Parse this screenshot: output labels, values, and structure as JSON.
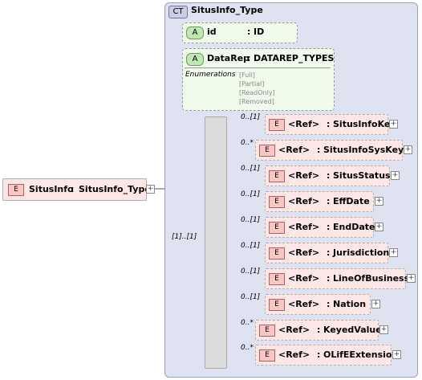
{
  "root": {
    "tag": "E",
    "name": "SitusInfo",
    "type": "SitusInfo_Type",
    "sep": ":"
  },
  "complex_type": {
    "tag": "CT",
    "name": "SitusInfo_Type"
  },
  "attributes": [
    {
      "tag": "A",
      "name": "id",
      "type": "ID"
    },
    {
      "tag": "A",
      "name": "DataRep",
      "type": "DATAREP_TYPES",
      "enum_label": "Enumerations",
      "enums": [
        "[Full]",
        "[Partial]",
        "[ReadOnly]",
        "[Removed]"
      ]
    }
  ],
  "sequence": {
    "cardinality": "[1]..[1]"
  },
  "elements": [
    {
      "card": "0..[1]",
      "tag": "E",
      "ref": "<Ref>",
      "name": "SitusInfoKey"
    },
    {
      "card": "0..*",
      "tag": "E",
      "ref": "<Ref>",
      "name": "SitusInfoSysKey"
    },
    {
      "card": "0..[1]",
      "tag": "E",
      "ref": "<Ref>",
      "name": "SitusStatus"
    },
    {
      "card": "0..[1]",
      "tag": "E",
      "ref": "<Ref>",
      "name": "EffDate"
    },
    {
      "card": "0..[1]",
      "tag": "E",
      "ref": "<Ref>",
      "name": "EndDate"
    },
    {
      "card": "0..[1]",
      "tag": "E",
      "ref": "<Ref>",
      "name": "Jurisdiction"
    },
    {
      "card": "0..[1]",
      "tag": "E",
      "ref": "<Ref>",
      "name": "LineOfBusiness"
    },
    {
      "card": "0..[1]",
      "tag": "E",
      "ref": "<Ref>",
      "name": "Nation"
    },
    {
      "card": "0..*",
      "tag": "E",
      "ref": "<Ref>",
      "name": "KeyedValue"
    },
    {
      "card": "0..*",
      "tag": "E",
      "ref": "<Ref>",
      "name": "OLifEExtension"
    }
  ],
  "plus_symbol": "+",
  "colon": ":"
}
